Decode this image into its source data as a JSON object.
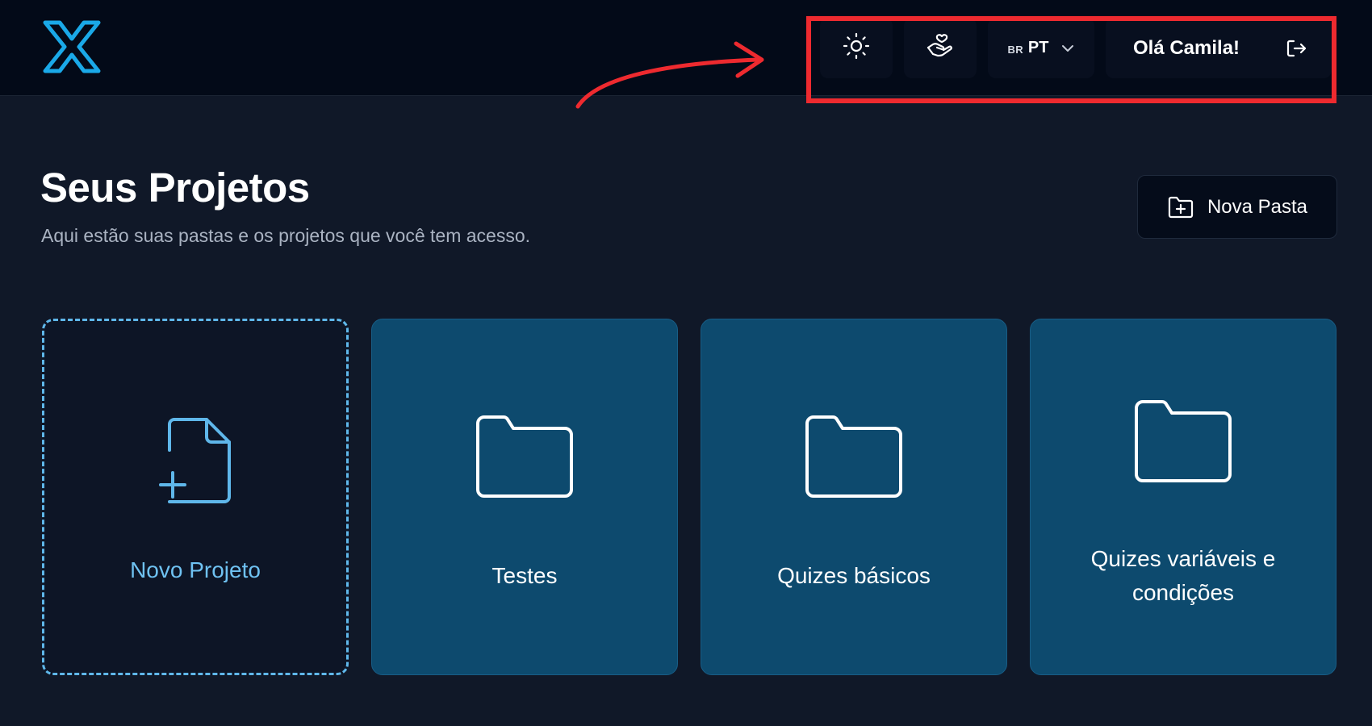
{
  "header": {
    "logo_icon": "x-logo-icon",
    "theme_icon": "sun-icon",
    "accessibility_icon": "hand-heart-icon",
    "language": {
      "flag": "BR",
      "code": "PT",
      "icon": "chevron-down-icon"
    },
    "greeting": "Olá Camila!",
    "logout_icon": "logout-icon"
  },
  "page": {
    "title": "Seus Projetos",
    "subtitle": "Aqui estão suas pastas e os projetos que você tem acesso.",
    "new_folder_button": "Nova Pasta",
    "new_folder_icon": "folder-plus-icon"
  },
  "cards": [
    {
      "label": "Novo Projeto",
      "icon": "file-plus-icon",
      "type": "new"
    },
    {
      "label": "Testes",
      "icon": "folder-icon",
      "type": "folder"
    },
    {
      "label": "Quizes básicos",
      "icon": "folder-icon",
      "type": "folder"
    },
    {
      "label": "Quizes variáveis e condições",
      "icon": "folder-icon",
      "type": "folder"
    }
  ],
  "colors": {
    "background": "#101828",
    "topbar": "#030a18",
    "accent": "#5fb7ea",
    "folder_card": "#0d4a6e",
    "annotation": "#ee2a2f"
  }
}
